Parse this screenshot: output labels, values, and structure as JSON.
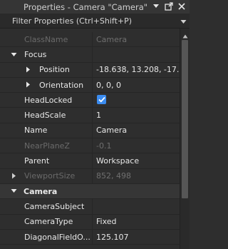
{
  "window": {
    "title": "Properties - Camera \"Camera\"",
    "filter_placeholder": "Filter Properties (Ctrl+Shift+P)"
  },
  "properties": {
    "classname": {
      "name": "ClassName",
      "value": "Camera"
    },
    "focus": {
      "name": "Focus"
    },
    "position": {
      "name": "Position",
      "value": "-18.638, 13.208, -17...."
    },
    "orientation": {
      "name": "Orientation",
      "value": "0, 0, 0"
    },
    "headlocked": {
      "name": "HeadLocked",
      "checked": true
    },
    "headscale": {
      "name": "HeadScale",
      "value": "1"
    },
    "name": {
      "name": "Name",
      "value": "Camera"
    },
    "nearplanez": {
      "name": "NearPlaneZ",
      "value": "-0.1"
    },
    "parent": {
      "name": "Parent",
      "value": "Workspace"
    },
    "viewportsize": {
      "name": "ViewportSize",
      "value": "852, 498"
    }
  },
  "camera_section": {
    "label": "Camera",
    "camerasubject": {
      "name": "CameraSubject",
      "value": ""
    },
    "cameratype": {
      "name": "CameraType",
      "value": "Fixed"
    },
    "diagonalfieldofview": {
      "name": "DiagonalFieldO...",
      "value": "125.107"
    }
  },
  "colors": {
    "accent": "#3b8cf0",
    "panel_bg": "#2e2e2e",
    "category_bg": "#363636"
  }
}
